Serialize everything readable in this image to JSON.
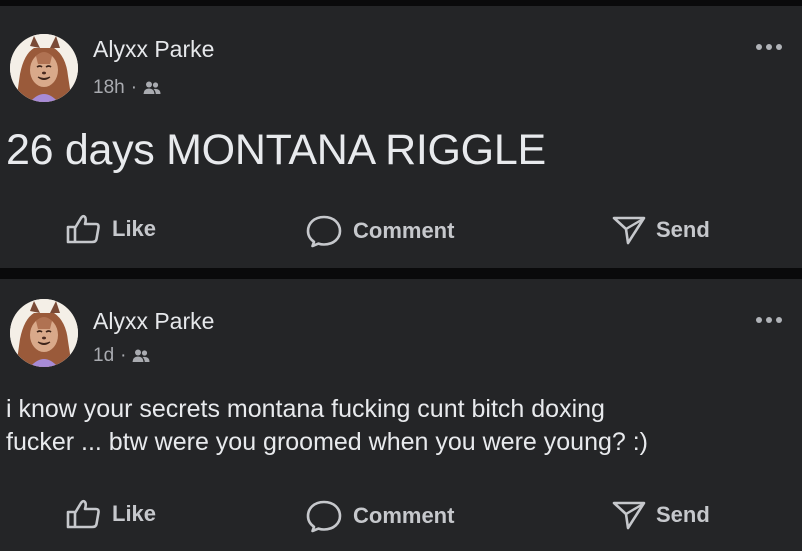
{
  "posts": [
    {
      "author": "Alyxx Parke",
      "time": "18h",
      "separator": "·",
      "audience_icon": "friends-icon",
      "text": "26 days MONTANA RIGGLE",
      "actions": {
        "like": "Like",
        "comment": "Comment",
        "send": "Send"
      }
    },
    {
      "author": "Alyxx Parke",
      "time": "1d",
      "separator": "·",
      "audience_icon": "friends-icon",
      "text_lines": [
        "i know your secrets montana fucking cunt bitch doxing",
        "fucker ... btw were you groomed when you were young? :)"
      ],
      "actions": {
        "like": "Like",
        "comment": "Comment",
        "send": "Send"
      }
    }
  ],
  "colors": {
    "background": "#0a0a0b",
    "card": "#242527",
    "primary_text": "#e8eaed",
    "secondary_text": "#a9abb0",
    "action_text": "#c6c8cc"
  }
}
